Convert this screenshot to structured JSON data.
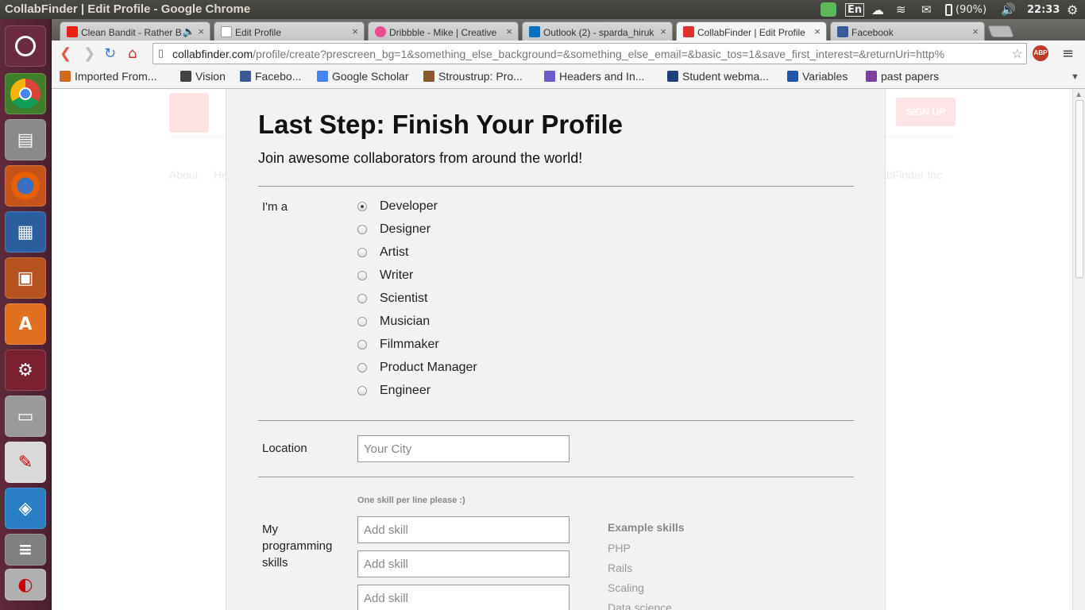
{
  "window": {
    "title": "CollabFinder | Edit Profile - Google Chrome"
  },
  "indicators": {
    "lang": "En",
    "battery": "(90%)",
    "time": "22:33"
  },
  "launcher": {
    "items": [
      "ubuntu-dash",
      "chrome",
      "file-cabinet",
      "firefox",
      "libreoffice-writer",
      "libreoffice-impress",
      "software-center",
      "system-settings",
      "disk",
      "evince",
      "virtualbox",
      "stack",
      "anaglyph"
    ]
  },
  "tabs": [
    {
      "label": "Clean Bandit - Rather B",
      "color": "#e62117"
    },
    {
      "label": "Edit Profile",
      "color": "#ffffff"
    },
    {
      "label": "Dribbble - Mike | Creative",
      "color": "#ea4c89"
    },
    {
      "label": "Outlook (2) - sparda_hiruk",
      "color": "#0072c6"
    },
    {
      "label": "CollabFinder | Edit Profile",
      "color": "#e03030"
    },
    {
      "label": "Facebook",
      "color": "#3b5998"
    }
  ],
  "url": {
    "domain": "collabfinder.com",
    "path": "/profile/create?prescreen_bg=1&something_else_background=&something_else_email=&basic_tos=1&save_first_interest=&returnUri=http%"
  },
  "bookmarks": [
    {
      "label": "Imported From...",
      "color": "#d2691e"
    },
    {
      "label": "Vision",
      "color": "#444444"
    },
    {
      "label": "Facebo...",
      "color": "#3b5998"
    },
    {
      "label": "Google Scholar",
      "color": "#4285f4"
    },
    {
      "label": "Stroustrup: Pro...",
      "color": "#8b5a2b"
    },
    {
      "label": "Headers and In...",
      "color": "#6a5acd"
    },
    {
      "label": "Student webma...",
      "color": "#1f3f7f"
    },
    {
      "label": "Variables",
      "color": "#2255aa"
    },
    {
      "label": "past papers",
      "color": "#7b3fa0"
    }
  ],
  "background": {
    "signup": "SIGN UP",
    "about": "About",
    "he": "He",
    "copyright": "labFinder Inc."
  },
  "form": {
    "title": "Last Step: Finish Your Profile",
    "subtitle": "Join awesome collaborators from around the world!",
    "role_label": "I'm a",
    "roles": [
      "Developer",
      "Designer",
      "Artist",
      "Writer",
      "Scientist",
      "Musician",
      "Filmmaker",
      "Product Manager",
      "Engineer"
    ],
    "selected_role": "Developer",
    "location_label": "Location",
    "location_placeholder": "Your City",
    "skills_hint": "One skill per line please :)",
    "skills_label": "My programming skills",
    "skill_placeholder": "Add skill",
    "example_title": "Example skills",
    "examples": [
      "PHP",
      "Rails",
      "Scaling",
      "Data science"
    ]
  }
}
